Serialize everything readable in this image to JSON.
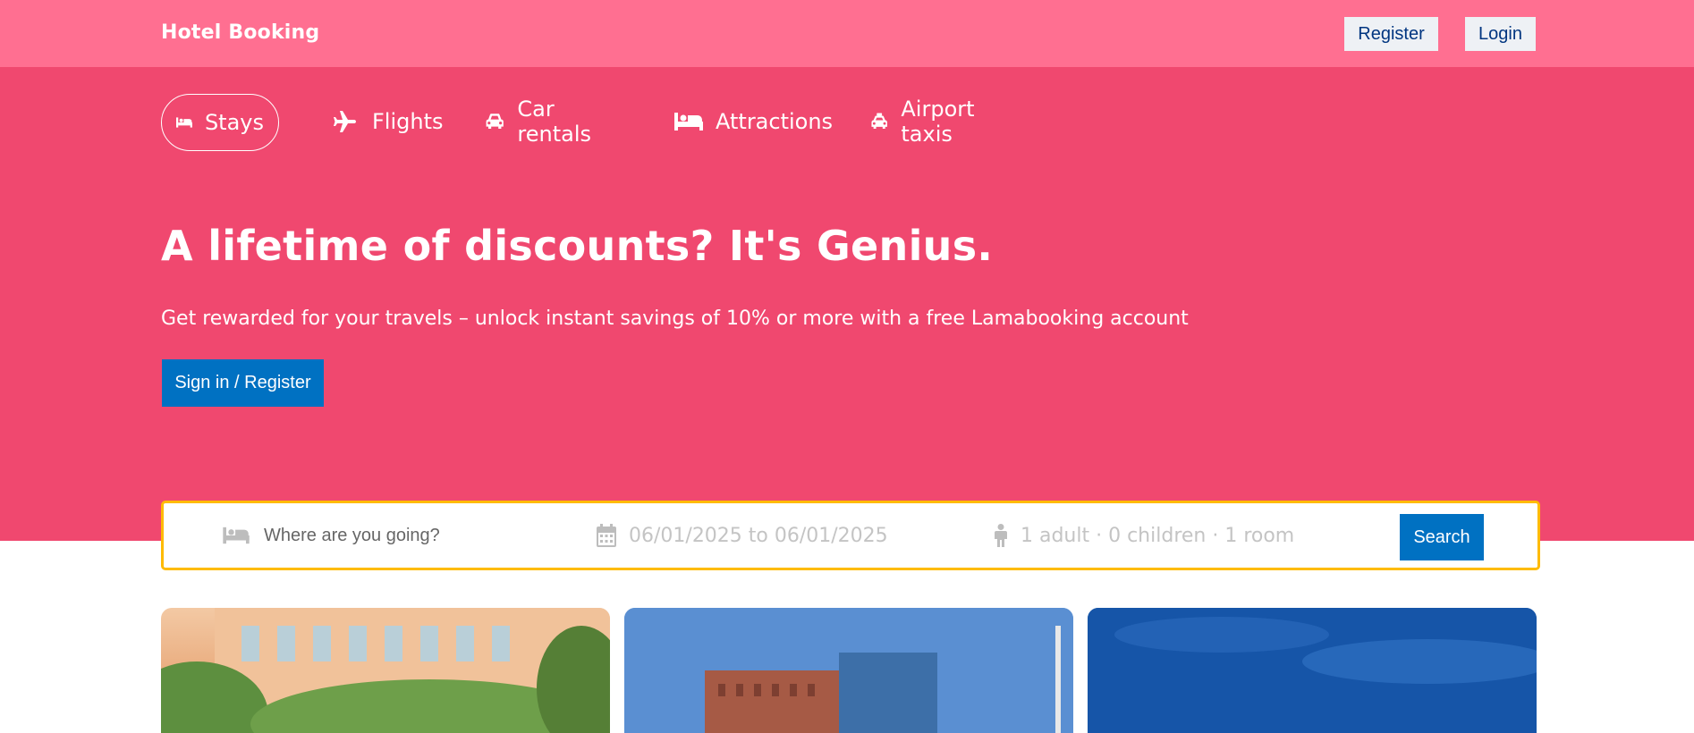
{
  "header": {
    "brand": "Hotel Booking",
    "register_label": "Register",
    "login_label": "Login"
  },
  "nav": {
    "tabs": [
      {
        "label": "Stays",
        "icon": "bed-icon",
        "active": true
      },
      {
        "label": "Flights",
        "icon": "plane-icon",
        "active": false
      },
      {
        "label": "Car rentals",
        "icon": "car-icon",
        "active": false
      },
      {
        "label": "Attractions",
        "icon": "bed-icon",
        "active": false
      },
      {
        "label": "Airport taxis",
        "icon": "taxi-icon",
        "active": false
      }
    ]
  },
  "hero": {
    "title": "A lifetime of discounts? It's Genius.",
    "description": "Get rewarded for your travels – unlock instant savings of 10% or more with a free Lamabooking account",
    "cta_label": "Sign in / Register"
  },
  "search": {
    "destination_placeholder": "Where are you going?",
    "date_range": "06/01/2025 to 06/01/2025",
    "guests": "1 adult · 0 children · 1 room",
    "button_label": "Search"
  },
  "colors": {
    "topbar": "#ff6f91",
    "hero": "#f0486f",
    "primary_button": "#0071c2",
    "search_border": "#febb02"
  }
}
